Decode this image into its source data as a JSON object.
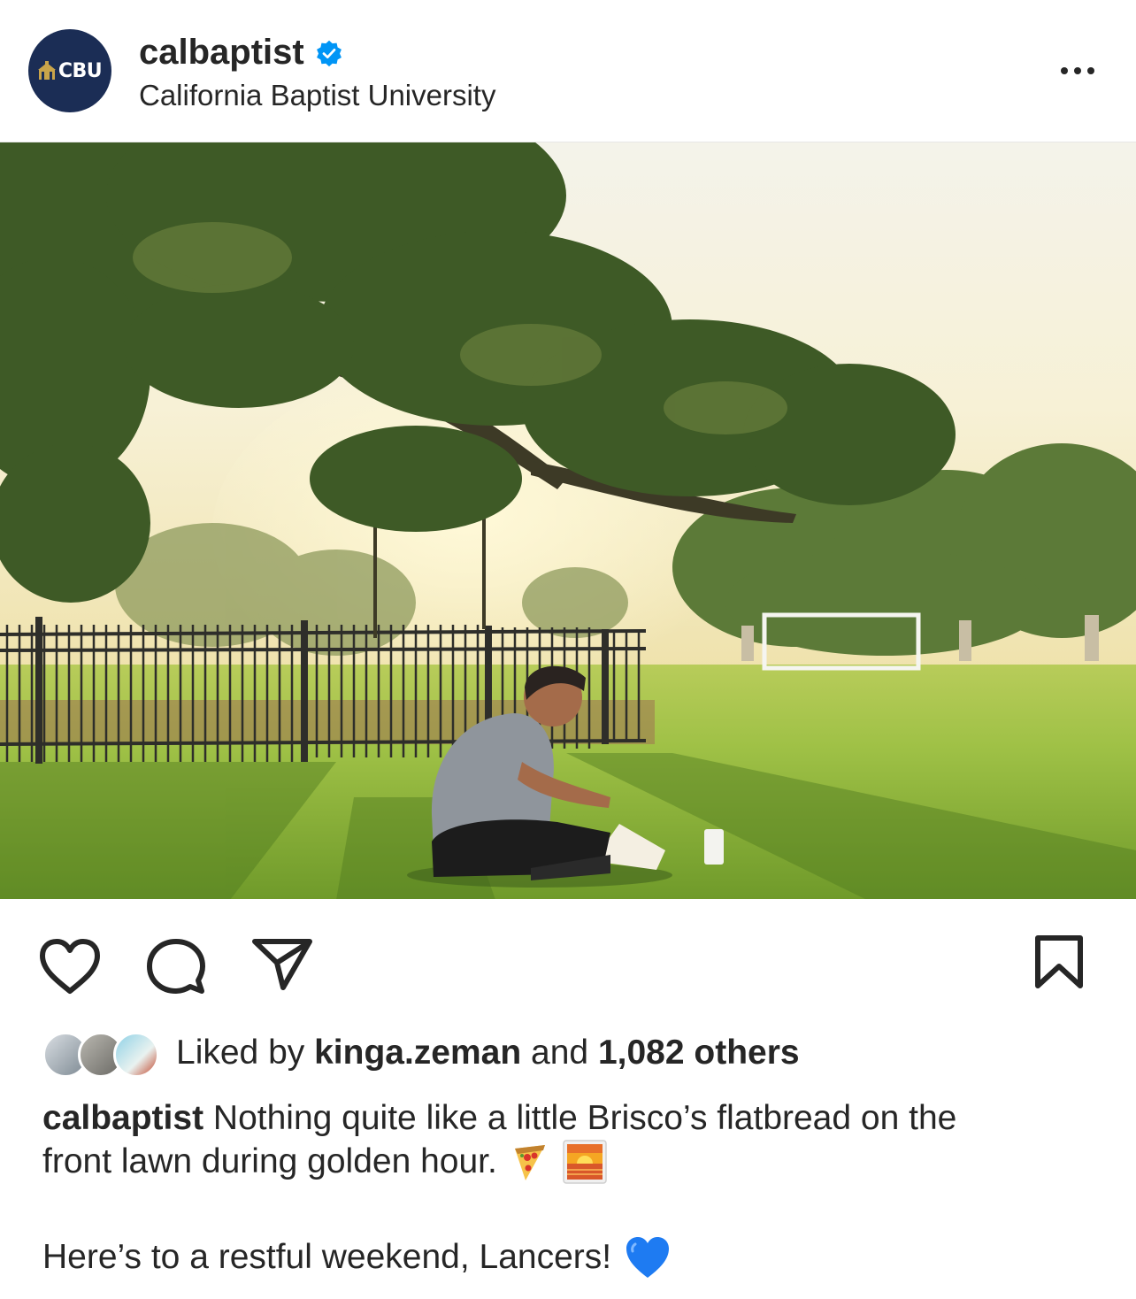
{
  "post": {
    "username": "calbaptist",
    "verified": true,
    "full_name": "California Baptist University",
    "avatar_text": "CBU",
    "menu_icon": "more-horizontal-icon"
  },
  "photo": {
    "icon": "post-photo"
  },
  "actions": {
    "like_icon": "heart-icon",
    "comment_icon": "comment-icon",
    "share_icon": "send-icon",
    "save_icon": "bookmark-icon"
  },
  "likes": {
    "prefix": "Liked by",
    "first_liker": "kinga.zeman",
    "connector": "and",
    "others": "1,082 others"
  },
  "caption": {
    "username": "calbaptist",
    "line1_text": "Nothing quite like a little Brisco’s flatbread on the",
    "line2_text": "front lawn during golden hour.",
    "line2_emojis": [
      "pizza-emoji",
      "sunrise-emoji"
    ],
    "line3_text": "Here’s to a restful weekend, Lancers!",
    "line3_emoji": "blue-heart-emoji"
  },
  "colors": {
    "verified_blue": "#0095f6",
    "avatar_navy": "#1b2d55",
    "text": "#262626"
  }
}
